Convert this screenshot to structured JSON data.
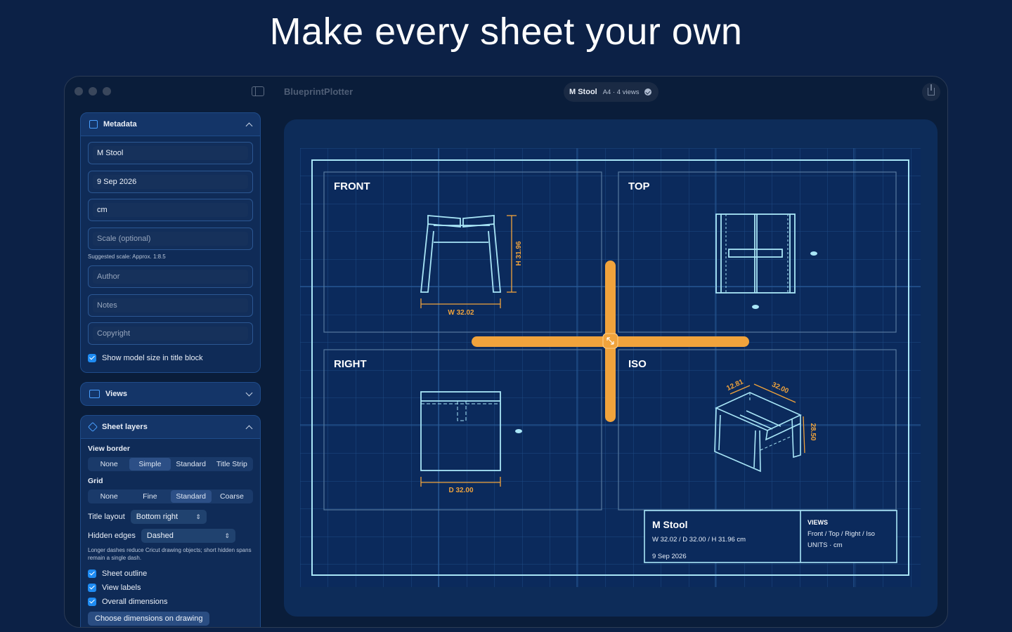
{
  "headline": "Make every sheet your own",
  "app": {
    "name": "BlueprintPlotter",
    "doc_title": "M Stool",
    "doc_subtitle": "A4 · 4 views"
  },
  "metadata_panel": {
    "title": "Metadata",
    "fields": [
      {
        "value": "M Stool",
        "placeholder": ""
      },
      {
        "value": "9 Sep 2026",
        "placeholder": ""
      },
      {
        "value": "cm",
        "placeholder": ""
      },
      {
        "value": "",
        "placeholder": "Scale (optional)"
      },
      {
        "value": "",
        "placeholder": "Author"
      },
      {
        "value": "",
        "placeholder": "Notes"
      },
      {
        "value": "",
        "placeholder": "Copyright"
      }
    ],
    "scale_hint": "Suggested scale: Approx. 1:8.5",
    "show_model_size_label": "Show model size in title block"
  },
  "views_panel": {
    "title": "Views"
  },
  "layers_panel": {
    "title": "Sheet layers",
    "view_border_label": "View border",
    "view_border_options": [
      "None",
      "Simple",
      "Standard",
      "Title Strip"
    ],
    "view_border_selected": "Simple",
    "grid_label": "Grid",
    "grid_options": [
      "None",
      "Fine",
      "Standard",
      "Coarse"
    ],
    "grid_selected": "Standard",
    "title_layout_label": "Title layout",
    "title_layout_value": "Bottom right",
    "hidden_edges_label": "Hidden edges",
    "hidden_edges_value": "Dashed",
    "hidden_edges_note": "Longer dashes reduce Cricut drawing objects; short hidden spans remain a single dash.",
    "checks": [
      "Sheet outline",
      "View labels",
      "Overall dimensions"
    ],
    "choose_button": "Choose dimensions on drawing"
  },
  "sheet": {
    "views": {
      "front": "FRONT",
      "top": "TOP",
      "right": "RIGHT",
      "iso": "ISO"
    },
    "dims": {
      "front_w": "W 32.02",
      "front_h": "H 31.96",
      "right_d": "D 32.00",
      "iso_a": "12.81",
      "iso_b": "32.00",
      "iso_c": "28.50"
    },
    "title_block": {
      "title": "M Stool",
      "size": "W 32.02 / D 32.00 / H 31.96 cm",
      "date": "9 Sep 2026",
      "views_heading": "VIEWS",
      "views_list": "Front / Top / Right / Iso",
      "units": "UNITS · cm"
    }
  },
  "colors": {
    "background": "#0c2146",
    "line": "#a9e6f7",
    "accent": "#f0a33c",
    "checkbox": "#1e8bf2"
  }
}
